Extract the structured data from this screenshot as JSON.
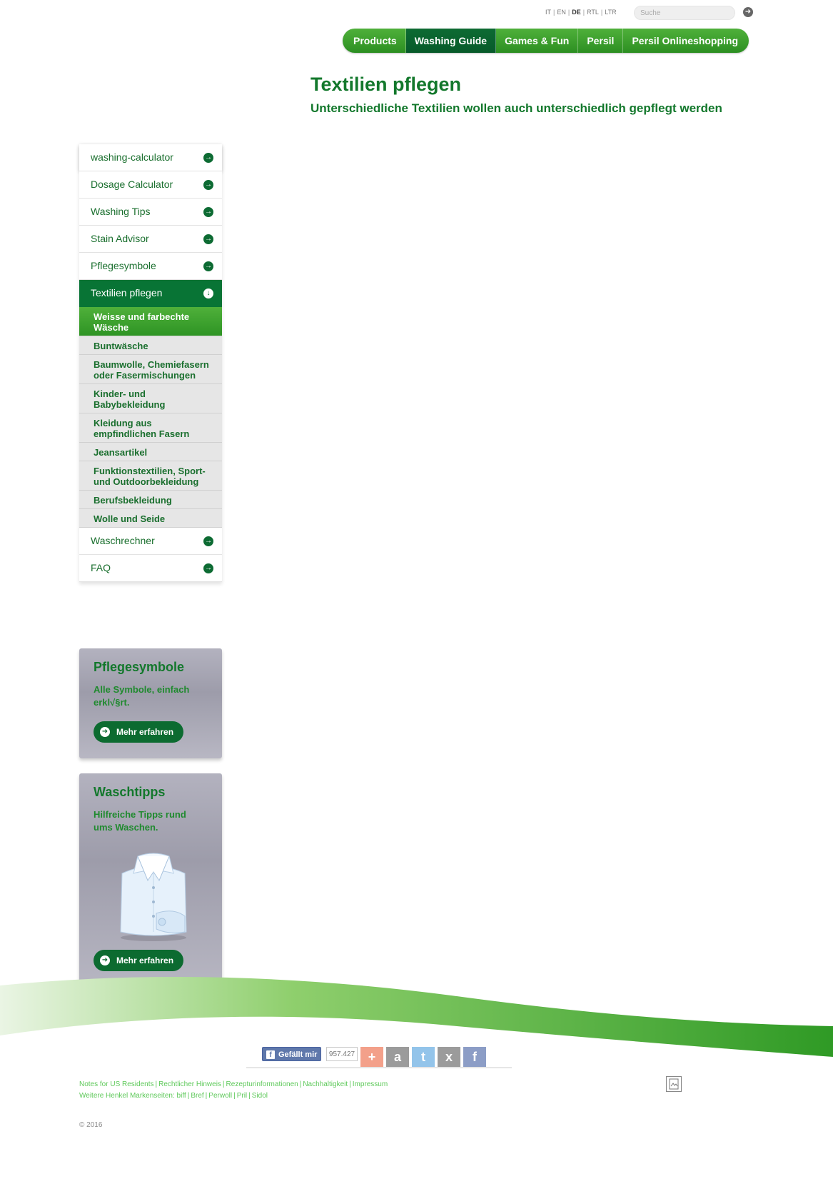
{
  "language_bar": {
    "languages": [
      {
        "label": "IT",
        "active": false
      },
      {
        "label": "EN",
        "active": false
      },
      {
        "label": "DE",
        "active": true
      },
      {
        "label": "RTL",
        "active": false
      },
      {
        "label": "LTR",
        "active": false
      }
    ],
    "search_placeholder": "Suche"
  },
  "main_nav": {
    "items": [
      {
        "label": "Products",
        "active": false
      },
      {
        "label": "Washing Guide",
        "active": true
      },
      {
        "label": "Games & Fun",
        "active": false
      },
      {
        "label": "Persil",
        "active": false
      },
      {
        "label": "Persil Onlineshopping",
        "active": false
      }
    ]
  },
  "header": {
    "title": "Textilien pflegen",
    "subtitle": "Unterschiedliche Textilien wollen auch unterschiedlich gepflegt werden"
  },
  "sidebar": {
    "items_before": [
      {
        "label": "washing-calculator"
      },
      {
        "label": "Dosage Calculator"
      },
      {
        "label": "Washing Tips"
      },
      {
        "label": "Stain Advisor"
      },
      {
        "label": "Pflegesymbole"
      }
    ],
    "active_item": {
      "label": "Textilien pflegen"
    },
    "subitems": [
      {
        "label": "Weisse und farbechte Wäsche",
        "active": true
      },
      {
        "label": "Buntwäsche",
        "active": false
      },
      {
        "label": "Baumwolle, Chemiefasern oder Fasermischungen",
        "active": false
      },
      {
        "label": "Kinder- und Babybekleidung",
        "active": false
      },
      {
        "label": "Kleidung aus empfindlichen Fasern",
        "active": false
      },
      {
        "label": "Jeansartikel",
        "active": false
      },
      {
        "label": "Funktionstextilien, Sport- und Outdoorbekleidung",
        "active": false
      },
      {
        "label": "Berufsbekleidung",
        "active": false
      },
      {
        "label": "Wolle und Seide",
        "active": false
      }
    ],
    "items_after": [
      {
        "label": "Waschrechner"
      },
      {
        "label": "FAQ"
      }
    ]
  },
  "promos": [
    {
      "title": "Pflegesymbole",
      "text": "Alle Symbole, einfach erkl√§rt.",
      "button": "Mehr erfahren"
    },
    {
      "title": "Waschtipps",
      "text": "Hilfreiche Tipps rund ums Waschen.",
      "button": "Mehr erfahren"
    }
  ],
  "social": {
    "like_label": "Gefällt mir",
    "like_count": "957.427",
    "share_icons": [
      {
        "name": "addthis-icon",
        "glyph": "+",
        "color": "#f3a08a"
      },
      {
        "name": "amazon-icon",
        "glyph": "a",
        "color": "#9b9b9b"
      },
      {
        "name": "twitter-icon",
        "glyph": "t",
        "color": "#93c4ea"
      },
      {
        "name": "xing-icon",
        "glyph": "x",
        "color": "#9b9b9b"
      },
      {
        "name": "facebook-icon",
        "glyph": "f",
        "color": "#8c9dc6"
      }
    ]
  },
  "footer": {
    "line1": [
      "Notes for US Residents",
      "Rechtlicher Hinweis",
      "Rezepturinformationen",
      "Nachhaltigkeit",
      "Impressum"
    ],
    "line2_prefix": "Weitere Henkel Markenseiten:",
    "line2": [
      "biff",
      "Bref",
      "Perwoll",
      "Pril",
      "Sidol"
    ],
    "copyright": "© 2016"
  },
  "colors": {
    "brand_green": "#13782c",
    "nav_green": "#2c8f22",
    "nav_active": "#075a2a",
    "link_green": "#5ec95a"
  }
}
